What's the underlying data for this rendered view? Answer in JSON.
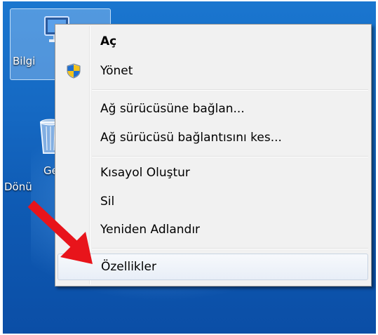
{
  "desktop": {
    "computer_label": "Bilgi",
    "recycle_label_line1": "Ge",
    "recycle_label_line2": "Dönü"
  },
  "menu": {
    "items": [
      {
        "label": "Aç",
        "bold": true
      },
      {
        "label": "Yönet",
        "icon": "uac-shield-icon"
      },
      {
        "label": "Ağ sürücüsüne bağlan..."
      },
      {
        "label": "Ağ sürücüsü bağlantısını kes..."
      },
      {
        "label": "Kısayol Oluştur"
      },
      {
        "label": "Sil"
      },
      {
        "label": "Yeniden Adlandır"
      },
      {
        "label": "Özellikler",
        "highlighted": true
      }
    ]
  },
  "annotation": {
    "arrow_color": "#e8141b"
  },
  "colors": {
    "desktop_blue": "#1568c2",
    "menu_bg": "#f1f1f1"
  }
}
